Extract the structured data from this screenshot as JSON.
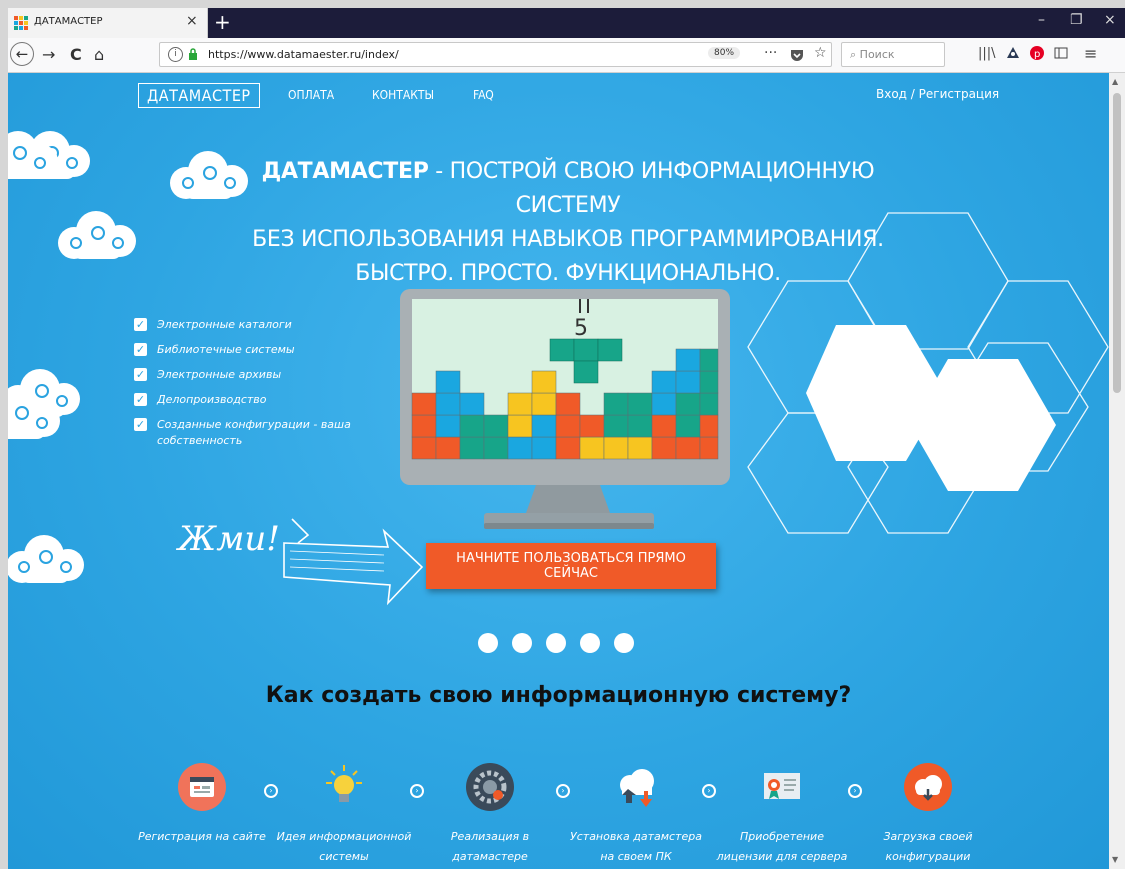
{
  "browser": {
    "tab_title": "ДАТАМАСТЕР",
    "tab_close": "×",
    "new_tab": "+",
    "win_min": "–",
    "win_max": "❐",
    "win_close": "×",
    "url": "https://www.datamaester.ru/index/",
    "zoom": "80%",
    "page_actions": "···",
    "search_placeholder": "Поиск",
    "nav_back": "←",
    "nav_forward": "→",
    "nav_reload": "C",
    "nav_home": "⌂"
  },
  "site": {
    "logo": "ДАТАМАСТЕР",
    "menu": [
      "ОПЛАТА",
      "КОНТАКТЫ",
      "FAQ"
    ],
    "login": "Вход / Регистрация",
    "headline_brand": "ДАТАМАСТЕР",
    "headline_rest": " - ПОСТРОЙ СВОЮ ИНФОРМАЦИОННУЮ СИСТЕМУ",
    "headline_line2": "БЕЗ ИСПОЛЬЗОВАНИЯ НАВЫКОВ ПРОГРАММИРОВАНИЯ.",
    "headline_line3": "БЫСТРО. ПРОСТО. ФУНКЦИОНАЛЬНО.",
    "features": [
      "Электронные каталоги",
      "Библиотечные системы",
      "Электронные архивы",
      "Делопроизводство",
      "Созданные конфигурации - ваша собственность"
    ],
    "zhmi": "Жми!",
    "cta": "НАЧНИТЕ ПОЛЬЗОВАТЬСЯ ПРЯМО СЕЙЧАС",
    "how_title": "Как создать свою информационную систему?",
    "steps": [
      "Регистрация на сайте",
      "Идея информационной системы",
      "Реализация в датамастере",
      "Установка датамстера на своем ПК",
      "Приобретение лицензии для сервера",
      "Загрузка своей конфигурации"
    ]
  },
  "colors": {
    "page_bg": "#2aa3e0",
    "cta_bg": "#f05a28",
    "tetris_orange": "#f05a28",
    "tetris_blue": "#1aa7e0",
    "tetris_green": "#17a589",
    "tetris_yellow": "#f7c520"
  }
}
